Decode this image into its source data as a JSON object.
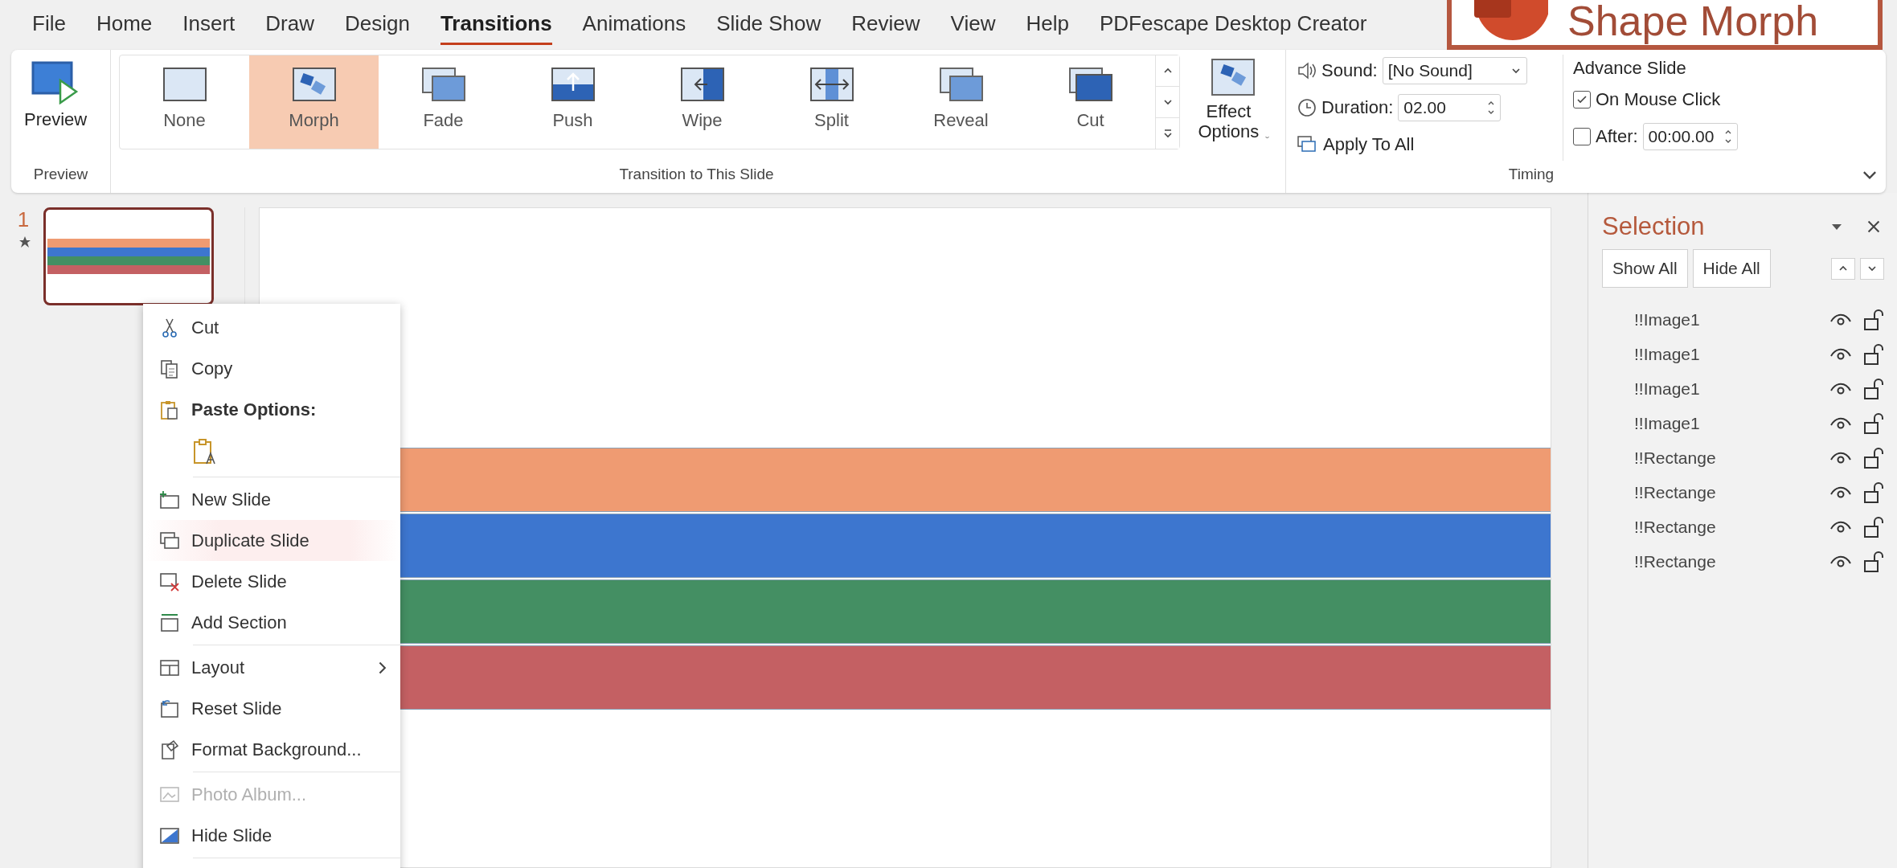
{
  "menu_tabs": [
    {
      "label": "File",
      "selected": false
    },
    {
      "label": "Home",
      "selected": false
    },
    {
      "label": "Insert",
      "selected": false
    },
    {
      "label": "Draw",
      "selected": false
    },
    {
      "label": "Design",
      "selected": false
    },
    {
      "label": "Transitions",
      "selected": true
    },
    {
      "label": "Animations",
      "selected": false
    },
    {
      "label": "Slide Show",
      "selected": false
    },
    {
      "label": "Review",
      "selected": false
    },
    {
      "label": "View",
      "selected": false
    },
    {
      "label": "Help",
      "selected": false
    },
    {
      "label": "PDFescape Desktop Creator",
      "selected": false
    }
  ],
  "banner": {
    "title": "Shape Morph"
  },
  "ribbon": {
    "preview": {
      "button": "Preview",
      "group_label": "Preview"
    },
    "transitions": {
      "items": [
        {
          "label": "None",
          "selected": false
        },
        {
          "label": "Morph",
          "selected": true
        },
        {
          "label": "Fade",
          "selected": false
        },
        {
          "label": "Push",
          "selected": false
        },
        {
          "label": "Wipe",
          "selected": false
        },
        {
          "label": "Split",
          "selected": false
        },
        {
          "label": "Reveal",
          "selected": false
        },
        {
          "label": "Cut",
          "selected": false
        }
      ],
      "effect_options": "Effect Options",
      "group_label": "Transition to This Slide"
    },
    "timing": {
      "sound": {
        "label": "Sound:",
        "value": "[No Sound]"
      },
      "duration": {
        "label": "Duration:",
        "value": "02.00"
      },
      "apply_all": "Apply To All",
      "advance_title": "Advance Slide",
      "on_mouse_click": {
        "label": "On Mouse Click",
        "checked": true
      },
      "after": {
        "label": "After:",
        "checked": false,
        "value": "00:00.00"
      },
      "group_label": "Timing"
    }
  },
  "slides": [
    {
      "number": "1",
      "has_transition": true,
      "selected": true
    }
  ],
  "slide": {
    "shapes": [
      {
        "color": "#ef9b72"
      },
      {
        "color": "#3d76cf"
      },
      {
        "color": "#448f63"
      },
      {
        "color": "#c46063"
      }
    ]
  },
  "context_menu": [
    {
      "kind": "command",
      "label": "Cut",
      "selected": false,
      "disabled": false
    },
    {
      "kind": "command",
      "label": "Copy",
      "selected": false,
      "disabled": false
    },
    {
      "kind": "header",
      "label": "Paste Options:"
    },
    {
      "kind": "paste"
    },
    {
      "kind": "separator"
    },
    {
      "kind": "command",
      "label": "New Slide",
      "selected": false,
      "disabled": false
    },
    {
      "kind": "command",
      "label": "Duplicate Slide",
      "selected": true,
      "disabled": false
    },
    {
      "kind": "command",
      "label": "Delete Slide",
      "selected": false,
      "disabled": false
    },
    {
      "kind": "command",
      "label": "Add Section",
      "selected": false,
      "disabled": false
    },
    {
      "kind": "separator"
    },
    {
      "kind": "submenu",
      "label": "Layout",
      "selected": false,
      "disabled": false
    },
    {
      "kind": "command",
      "label": "Reset Slide",
      "selected": false,
      "disabled": false
    },
    {
      "kind": "command",
      "label": "Format Background...",
      "selected": false,
      "disabled": false
    },
    {
      "kind": "separator"
    },
    {
      "kind": "command",
      "label": "Photo Album...",
      "selected": false,
      "disabled": true
    },
    {
      "kind": "command",
      "label": "Hide Slide",
      "selected": false,
      "disabled": false
    },
    {
      "kind": "separator"
    }
  ],
  "selection_pane": {
    "title": "Selection",
    "show_all": "Show All",
    "hide_all": "Hide All",
    "items": [
      {
        "name": "!!Image1",
        "visible": true,
        "locked": false
      },
      {
        "name": "!!Image1",
        "visible": true,
        "locked": false
      },
      {
        "name": "!!Image1",
        "visible": true,
        "locked": false
      },
      {
        "name": "!!Image1",
        "visible": true,
        "locked": false
      },
      {
        "name": "!!Rectange",
        "visible": true,
        "locked": false
      },
      {
        "name": "!!Rectange",
        "visible": true,
        "locked": false
      },
      {
        "name": "!!Rectange",
        "visible": true,
        "locked": false
      },
      {
        "name": "!!Rectange",
        "visible": true,
        "locked": false
      }
    ]
  }
}
